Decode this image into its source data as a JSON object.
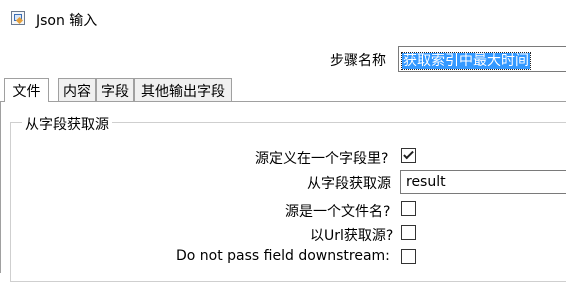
{
  "window": {
    "title": "Json 输入",
    "icon": "json-input-step-icon"
  },
  "step": {
    "label": "步骤名称",
    "value": "获取索引中最大时间"
  },
  "tabs": [
    {
      "label": "文件",
      "active": true
    },
    {
      "label": "内容",
      "active": false
    },
    {
      "label": "字段",
      "active": false
    },
    {
      "label": "其他输出字段",
      "active": false
    }
  ],
  "group": {
    "title": "从字段获取源",
    "source_in_field": {
      "label": "源定义在一个字段里?",
      "checked": true
    },
    "source_field": {
      "label": "从字段获取源",
      "value": "result"
    },
    "source_is_filename": {
      "label": "源是一个文件名?",
      "checked": false
    },
    "source_from_url": {
      "label": "以Url获取源?",
      "checked": false
    },
    "do_not_pass": {
      "label": "Do not pass field downstream:",
      "checked": false
    }
  }
}
